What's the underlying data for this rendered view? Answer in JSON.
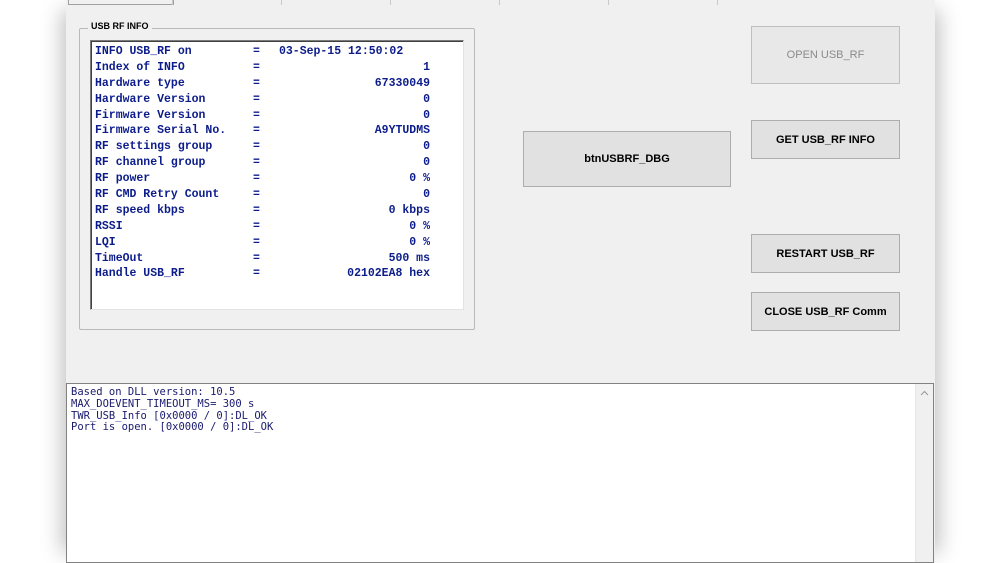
{
  "groupbox": {
    "title": "USB RF INFO"
  },
  "info_rows": [
    {
      "key": "INFO USB_RF on",
      "eq": "=",
      "value": "03-Sep-15 12:50:02",
      "align": "left"
    },
    {
      "key": "Index of INFO",
      "eq": "=",
      "value": "1"
    },
    {
      "key": "Hardware type",
      "eq": "=",
      "value": "67330049"
    },
    {
      "key": "Hardware Version",
      "eq": "=",
      "value": "0"
    },
    {
      "key": "Firmware Version",
      "eq": "=",
      "value": "0"
    },
    {
      "key": "Firmware Serial No.",
      "eq": "=",
      "value": "A9YTUDMS"
    },
    {
      "key": "RF settings group",
      "eq": "=",
      "value": "0"
    },
    {
      "key": "RF channel group",
      "eq": "=",
      "value": "0"
    },
    {
      "key": "RF power",
      "eq": "=",
      "value": "0 %"
    },
    {
      "key": "RF CMD Retry Count",
      "eq": "=",
      "value": "0"
    },
    {
      "key": "RF speed kbps",
      "eq": "=",
      "value": "0 kbps"
    },
    {
      "key": "RSSI",
      "eq": "=",
      "value": "0 %"
    },
    {
      "key": "LQI",
      "eq": "=",
      "value": "0 %"
    },
    {
      "key": "TimeOut",
      "eq": "=",
      "value": "500 ms"
    },
    {
      "key": "Handle USB_RF",
      "eq": "=",
      "value": "02102EA8 hex"
    }
  ],
  "buttons": {
    "open": "OPEN USB_RF",
    "get_info": "GET USB_RF INFO",
    "debug": "btnUSBRF_DBG",
    "restart": "RESTART USB_RF",
    "close": "CLOSE USB_RF Comm"
  },
  "log": {
    "lines": [
      "Based on DLL version: 10.5",
      "MAX_DOEVENT_TIMEOUT_MS= 300 s",
      "TWR_USB_Info [0x0000 / 0]:DL_OK",
      "Port is open. [0x0000 / 0]:DL_OK"
    ]
  },
  "icons": {
    "scroll_up": "chevron-up-icon"
  }
}
